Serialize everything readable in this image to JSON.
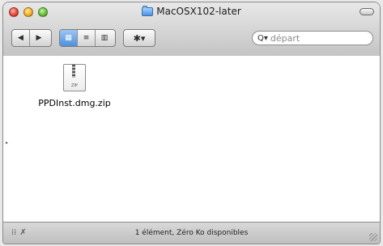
{
  "window": {
    "title": "MacOSX102-later"
  },
  "toolbar": {
    "back_label": "◀",
    "forward_label": "▶",
    "view_icons_label": "▦",
    "view_list_label": "≡",
    "view_columns_label": "▥",
    "action_label": "✱▾",
    "search_placeholder": "départ"
  },
  "content": {
    "files": [
      {
        "name": "PPDInst.dmg.zip",
        "icon": "zip-file-icon",
        "icon_label": "ZIP"
      }
    ]
  },
  "status": {
    "text": "1 élément, Zéro Ko disponibles"
  },
  "colors": {
    "selected_view": "#4e8fdd",
    "titlebar": "#d3d3d3"
  }
}
